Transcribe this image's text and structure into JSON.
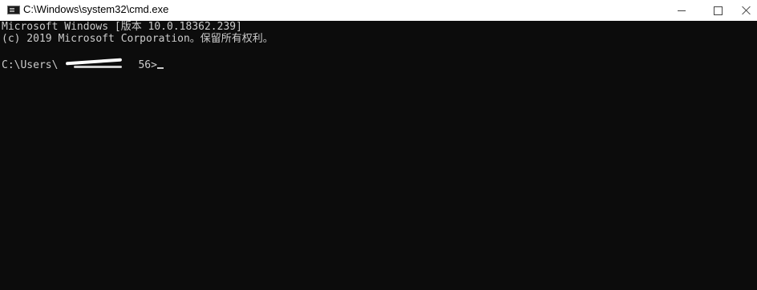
{
  "window": {
    "title": "C:\\Windows\\system32\\cmd.exe",
    "icon": "cmd-icon",
    "controls": [
      "minimize-icon",
      "maximize-icon",
      "close-icon"
    ]
  },
  "console": {
    "line1": "Microsoft Windows [版本 10.0.18362.239]",
    "line2": "(c) 2019 Microsoft Corporation。保留所有权利。",
    "prompt_prefix": "C:\\Users\\",
    "prompt_suffix": "56>",
    "colors": {
      "background": "#0c0c0c",
      "foreground": "#cccccc"
    }
  }
}
